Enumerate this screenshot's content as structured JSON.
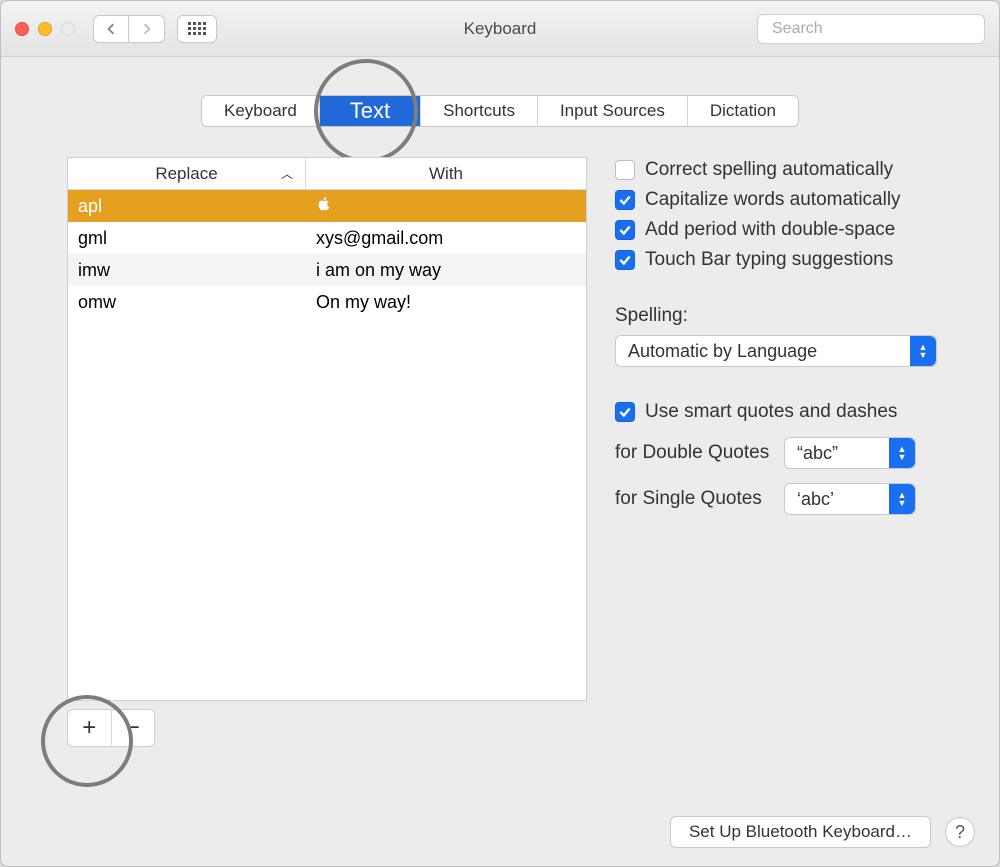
{
  "window": {
    "title": "Keyboard"
  },
  "search": {
    "placeholder": "Search"
  },
  "tabs": [
    "Keyboard",
    "Text",
    "Shortcuts",
    "Input Sources",
    "Dictation"
  ],
  "active_tab": 1,
  "table": {
    "headers": {
      "replace": "Replace",
      "with": "With"
    },
    "rows": [
      {
        "replace": "apl",
        "with": "",
        "selected": true
      },
      {
        "replace": "gml",
        "with": "xys@gmail.com"
      },
      {
        "replace": "imw",
        "with": "i am on my way"
      },
      {
        "replace": "omw",
        "with": "On my way!"
      }
    ]
  },
  "options": {
    "correct_spelling": {
      "label": "Correct spelling automatically",
      "checked": false
    },
    "capitalize": {
      "label": "Capitalize words automatically",
      "checked": true
    },
    "period_double_space": {
      "label": "Add period with double-space",
      "checked": true
    },
    "touchbar": {
      "label": "Touch Bar typing suggestions",
      "checked": true
    },
    "spelling_label": "Spelling:",
    "spelling_value": "Automatic by Language",
    "smart_quotes": {
      "label": "Use smart quotes and dashes",
      "checked": true
    },
    "double_quotes_label": "for Double Quotes",
    "double_quotes_value": "“abc”",
    "single_quotes_label": "for Single Quotes",
    "single_quotes_value": "‘abc’"
  },
  "buttons": {
    "add": "+",
    "remove": "−",
    "bluetooth": "Set Up Bluetooth Keyboard…",
    "help": "?"
  }
}
